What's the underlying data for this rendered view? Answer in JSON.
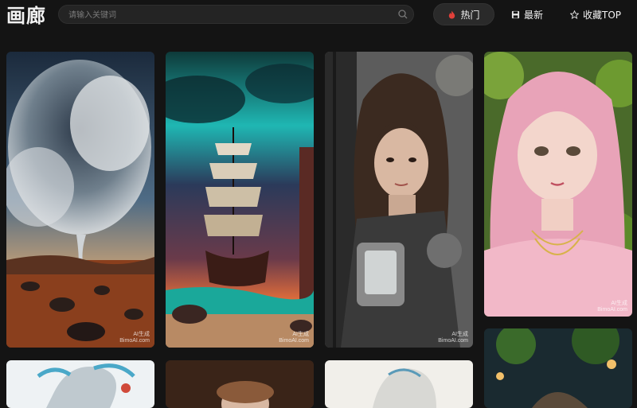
{
  "header": {
    "title": "画廊",
    "search_placeholder": "请输入关键词",
    "tabs": [
      {
        "label": "热门",
        "icon": "flame-icon",
        "active": true
      },
      {
        "label": "最新",
        "icon": "save-icon",
        "active": false
      },
      {
        "label": "收藏TOP",
        "icon": "star-icon",
        "active": false
      }
    ]
  },
  "gallery": {
    "items": [
      {
        "subject": "storm-cloud-desert",
        "wm1": "AI生成",
        "wm2": "BimoAI.com"
      },
      {
        "subject": "sailing-ship-aurora",
        "wm1": "AI生成",
        "wm2": "BimoAI.com"
      },
      {
        "subject": "woman-steampunk-armor",
        "wm1": "AI生成",
        "wm2": "BimoAI.com"
      },
      {
        "subject": "pink-hair-girl",
        "wm1": "AI生成",
        "wm2": "BimoAI.com"
      },
      {
        "subject": "anime-girl-blue-ribbons"
      },
      {
        "subject": "portrait-warm"
      },
      {
        "subject": "anime-girl-white-hair"
      },
      {
        "subject": "night-lanterns"
      }
    ]
  },
  "colors": {
    "background": "#141414",
    "flame": "#e0403a"
  }
}
